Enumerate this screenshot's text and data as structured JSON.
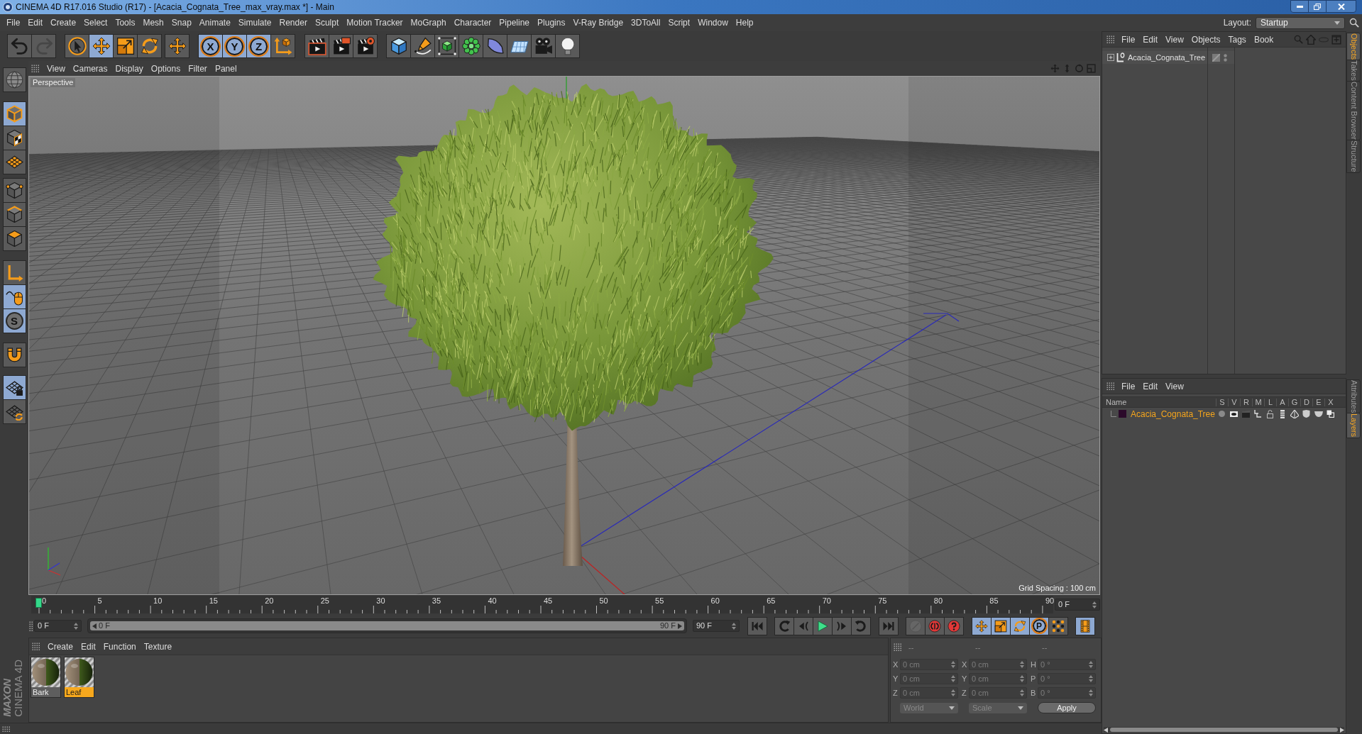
{
  "window": {
    "title": "CINEMA 4D R17.016 Studio (R17) - [Acacia_Cognata_Tree_max_vray.max *] - Main"
  },
  "menu_bar": {
    "items": [
      "File",
      "Edit",
      "Create",
      "Select",
      "Tools",
      "Mesh",
      "Snap",
      "Animate",
      "Simulate",
      "Render",
      "Sculpt",
      "Motion Tracker",
      "MoGraph",
      "Character",
      "Pipeline",
      "Plugins",
      "V-Ray Bridge",
      "3DToAll",
      "Script",
      "Window",
      "Help"
    ],
    "layout_label": "Layout:",
    "layout_value": "Startup"
  },
  "toolbar": {
    "buttons": [
      {
        "kind": "icon",
        "active": false,
        "disabled": false
      },
      {
        "kind": "icon",
        "active": false,
        "disabled": true
      },
      {
        "kind": "icon",
        "active": false,
        "disabled": false
      },
      {
        "kind": "icon",
        "active": true,
        "disabled": false
      },
      {
        "kind": "icon",
        "active": false,
        "disabled": false
      },
      {
        "kind": "icon",
        "active": false,
        "disabled": false
      },
      {
        "kind": "icon",
        "active": false,
        "disabled": false
      },
      {
        "kind": "letter",
        "label": "X",
        "active": true,
        "disabled": false
      },
      {
        "kind": "letter",
        "label": "Y",
        "active": true,
        "disabled": false
      },
      {
        "kind": "letter",
        "label": "Z",
        "active": true,
        "disabled": false
      },
      {
        "kind": "icon",
        "active": false,
        "disabled": false
      },
      {
        "kind": "icon",
        "active": false,
        "disabled": false
      },
      {
        "kind": "icon",
        "active": false,
        "disabled": false
      },
      {
        "kind": "icon",
        "active": false,
        "disabled": false
      },
      {
        "kind": "icon",
        "active": false,
        "disabled": false
      },
      {
        "kind": "icon",
        "active": false,
        "disabled": false
      },
      {
        "kind": "icon",
        "active": false,
        "disabled": false
      },
      {
        "kind": "icon",
        "active": false,
        "disabled": false
      },
      {
        "kind": "icon",
        "active": false,
        "disabled": false
      },
      {
        "kind": "icon",
        "active": false,
        "disabled": false
      },
      {
        "kind": "icon",
        "active": false,
        "disabled": false
      },
      {
        "kind": "icon",
        "active": false,
        "disabled": false
      }
    ]
  },
  "left_toolbar": {
    "buttons": [
      {
        "kind": "icon",
        "active": false
      },
      {
        "kind": "icon",
        "active": true
      },
      {
        "kind": "icon",
        "active": false
      },
      {
        "kind": "icon",
        "active": false
      },
      {
        "kind": "icon",
        "active": false
      },
      {
        "kind": "icon",
        "active": false
      },
      {
        "kind": "icon",
        "active": false
      },
      {
        "kind": "icon",
        "active": false
      },
      {
        "kind": "icon",
        "active": true
      },
      {
        "kind": "letter",
        "label": "S",
        "active": true
      },
      {
        "kind": "icon",
        "active": false
      },
      {
        "kind": "icon",
        "active": true
      },
      {
        "kind": "icon",
        "active": false
      }
    ]
  },
  "viewport": {
    "menu": [
      "View",
      "Cameras",
      "Display",
      "Options",
      "Filter",
      "Panel"
    ],
    "camera": "Perspective",
    "grid_spacing": "Grid Spacing : 100 cm"
  },
  "timeline": {
    "frames": [
      "0",
      "5",
      "10",
      "15",
      "20",
      "25",
      "30",
      "35",
      "40",
      "45",
      "50",
      "55",
      "60",
      "65",
      "70",
      "75",
      "80",
      "85",
      "90"
    ],
    "level": 0,
    "current_frame": "0 F"
  },
  "transport": {
    "start_field": "0 F",
    "range": {
      "start": "0 F",
      "end": "90 F",
      "level": 1
    },
    "end_field": "90 F",
    "buttons": [
      {
        "kind": "icon",
        "active": false,
        "disabled": false
      },
      {
        "kind": "icon",
        "active": false,
        "disabled": false
      },
      {
        "kind": "icon",
        "active": false,
        "disabled": false
      },
      {
        "kind": "icon",
        "active": false,
        "disabled": false
      },
      {
        "kind": "icon",
        "active": false,
        "disabled": false
      },
      {
        "kind": "icon",
        "active": false,
        "disabled": false
      },
      {
        "kind": "icon",
        "active": false,
        "disabled": false
      },
      {
        "kind": "icon",
        "active": false,
        "disabled": true
      },
      {
        "kind": "icon",
        "active": false,
        "disabled": false
      },
      {
        "kind": "icon",
        "active": false,
        "disabled": false
      },
      {
        "kind": "icon",
        "active": true,
        "disabled": false
      },
      {
        "kind": "icon",
        "active": true,
        "disabled": false
      },
      {
        "kind": "icon",
        "active": true,
        "disabled": false
      },
      {
        "kind": "letter",
        "label": "P",
        "active": true,
        "disabled": false
      },
      {
        "kind": "icon",
        "active": false,
        "disabled": false
      },
      {
        "kind": "icon",
        "active": true,
        "disabled": false
      }
    ]
  },
  "materials": {
    "menu": [
      "Create",
      "Edit",
      "Function",
      "Texture"
    ],
    "items": [
      {
        "name": "Bark",
        "selected": false
      },
      {
        "name": "Leaf",
        "selected": true
      }
    ]
  },
  "coordinates": {
    "disabled": true,
    "columns": [
      {
        "header": "--",
        "fields": [
          {
            "label": "X",
            "value": "0 cm"
          },
          {
            "label": "Y",
            "value": "0 cm"
          },
          {
            "label": "Z",
            "value": "0 cm"
          }
        ]
      },
      {
        "header": "--",
        "fields": [
          {
            "label": "X",
            "value": "0 cm"
          },
          {
            "label": "Y",
            "value": "0 cm"
          },
          {
            "label": "Z",
            "value": "0 cm"
          }
        ]
      },
      {
        "header": "--",
        "fields": [
          {
            "label": "H",
            "value": "0 °"
          },
          {
            "label": "P",
            "value": "0 °"
          },
          {
            "label": "B",
            "value": "0 °"
          }
        ]
      }
    ],
    "space_dropdown": "World",
    "size_dropdown": "Scale",
    "apply_button": "Apply"
  },
  "objects_manager": {
    "menu": [
      "File",
      "Edit",
      "View",
      "Objects",
      "Tags",
      "Book"
    ],
    "objects": [
      {
        "name": "Acacia_Cognata_Tree",
        "expanded": false
      }
    ]
  },
  "layer_manager": {
    "menu": [
      "File",
      "Edit",
      "View"
    ],
    "columns": [
      "Name",
      "S",
      "V",
      "R",
      "M",
      "L",
      "A",
      "G",
      "D",
      "E",
      "X"
    ],
    "layers": [
      {
        "name": "Acacia_Cognata_Tree",
        "color": "#2b0a2a"
      }
    ]
  },
  "side_tabs": {
    "top": [
      {
        "label": "Objects",
        "selected": true
      },
      {
        "label": "Takes",
        "selected": false
      },
      {
        "label": "Content Browser",
        "selected": false
      },
      {
        "label": "Structure",
        "selected": false
      }
    ],
    "bottom": [
      {
        "label": "Attributes",
        "selected": false
      },
      {
        "label": "Layers",
        "selected": true
      }
    ]
  },
  "logo": {
    "brand": "MAXON",
    "product": "CINEMA 4D"
  }
}
